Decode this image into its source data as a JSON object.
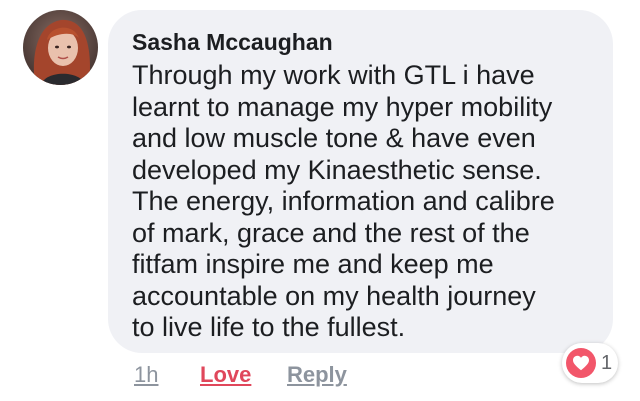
{
  "comment": {
    "author": "Sasha Mccaughan",
    "lines": [
      "Through my work with GTL i have",
      "learnt to manage my hyper mobility",
      "and low muscle tone & have even",
      "developed my Kinaesthetic sense.",
      "The energy, information and calibre",
      "of mark, grace and the rest of the",
      "fitfam inspire me and keep me",
      "accountable on my health journey",
      "to live life to the fullest."
    ]
  },
  "actions": {
    "time": "1h",
    "love": "Love",
    "reply": "Reply"
  },
  "reactions": {
    "icon": "heart-icon",
    "count": "1"
  },
  "colors": {
    "bubble": "#f0f1f5",
    "love_active": "#e0475b",
    "heart_badge": "#f2566a",
    "muted": "#8d949e"
  }
}
